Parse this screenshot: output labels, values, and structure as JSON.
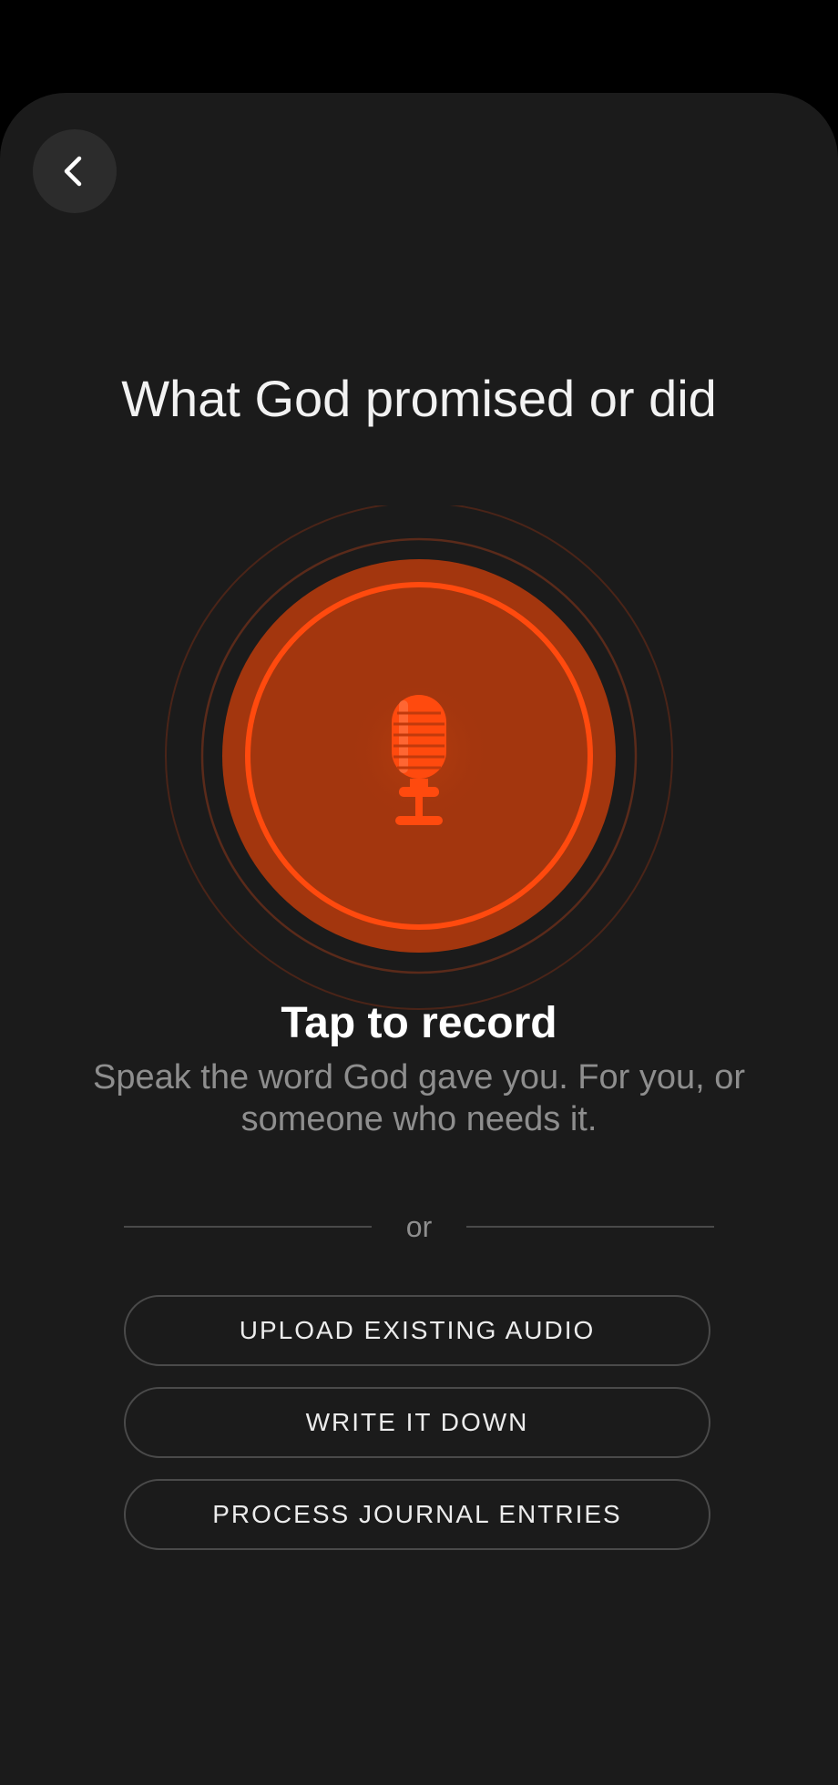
{
  "header": {
    "back_icon": "chevron-left-icon"
  },
  "prompt": {
    "title": "What God promised or did"
  },
  "recorder": {
    "mic_icon": "microphone-icon",
    "label": "Tap to record",
    "hint": "Speak the word God gave you. For you, or someone who needs it.",
    "accent_color": "#ff4a0e",
    "fill_color": "#a3360e"
  },
  "divider": {
    "text": "or"
  },
  "actions": {
    "upload_label": "UPLOAD EXISTING AUDIO",
    "write_label": "WRITE IT DOWN",
    "process_label": "PROCESS JOURNAL ENTRIES"
  },
  "theme": {
    "background": "#1b1b1b",
    "text_primary": "#f2f2f2",
    "text_secondary": "#8e8e8e"
  }
}
